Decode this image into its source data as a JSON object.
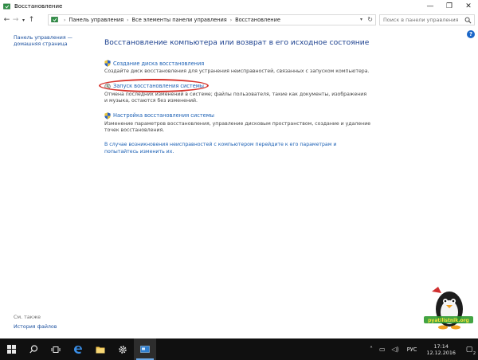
{
  "window": {
    "title": "Восстановление",
    "minimize": "—",
    "maximize": "❐",
    "close": "✕"
  },
  "address": {
    "breadcrumbs": [
      "Панель управления",
      "Все элементы панели управления",
      "Восстановление"
    ],
    "search_placeholder": "Поиск в панели управления"
  },
  "left_nav": {
    "home_line1": "Панель управления —",
    "home_line2": "домашняя страница",
    "see_also": "См. также",
    "file_history": "История файлов"
  },
  "main": {
    "heading": "Восстановление компьютера или возврат в его исходное состояние",
    "items": [
      {
        "link": "Создание диска восстановления",
        "desc": "Создайте диск восстановления для устранения неисправностей, связанных с запуском компьютера."
      },
      {
        "link": "Запуск восстановления системы",
        "desc": "Отмена последних изменений в системе; файлы пользователя, такие как документы, изображения и музыка, остаются без изменений."
      },
      {
        "link": "Настройка восстановления системы",
        "desc": "Изменение параметров восстановления, управление дисковым пространством, создание и удаление точек восстановления."
      }
    ],
    "reset_link": "В случае возникновения неисправностей с компьютером перейдите к его параметрам и попытайтесь изменить их."
  },
  "watermark": {
    "text": "pyatilistnik.org"
  },
  "taskbar": {
    "lang": "РУС",
    "time": "17:14",
    "date": "12.12.2016",
    "notifications": "2"
  },
  "colors": {
    "accent": "#1a5fb4",
    "highlight_ellipse": "#d7332c",
    "taskbar": "#101010"
  }
}
